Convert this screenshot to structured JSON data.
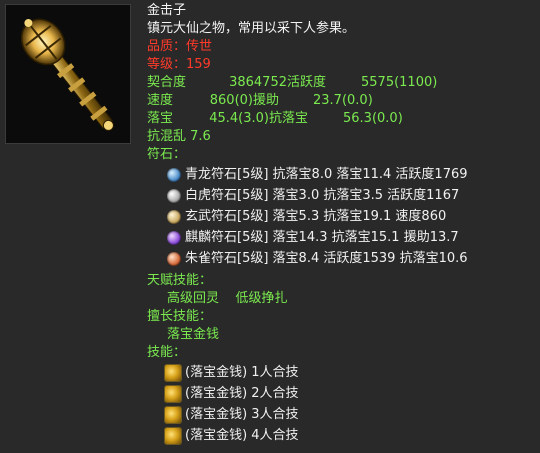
{
  "item": {
    "name": "金击子",
    "description": "镇元大仙之物，常用以采下人参果。",
    "quality_label": "品质：",
    "quality_value": "传世",
    "level_label": "等级：",
    "level_value": "159"
  },
  "stats": {
    "compat_label": "契合度",
    "compat_value": "3864752",
    "activity_label": "活跃度",
    "activity_value": "5575(1100)",
    "speed_label": "速度",
    "speed_value": "860(0)",
    "assist_label": "援助",
    "assist_value": "23.7(0.0)",
    "drop_label": "落宝",
    "drop_value": "45.4(3.0)",
    "anti_drop_label": "抗落宝",
    "anti_drop_value": "56.3(0.0)",
    "anti_chaos": "抗混乱 7.6"
  },
  "runes": {
    "header": "符石：",
    "items": [
      {
        "text": "青龙符石[5级] 抗落宝8.0 落宝11.4 活跃度1769",
        "color": "#6aa8d8"
      },
      {
        "text": "白虎符石[5级] 落宝3.0 抗落宝3.5 活跃度1167",
        "color": "#d0d0d0"
      },
      {
        "text": "玄武符石[5级] 落宝5.3 抗落宝19.1 速度860",
        "color": "#c9b07a"
      },
      {
        "text": "麒麟符石[5级] 落宝14.3 抗落宝15.1 援助13.7",
        "color": "#9a6ad8"
      },
      {
        "text": "朱雀符石[5级] 落宝8.4 活跃度1539 抗落宝10.6",
        "color": "#d86a3a"
      }
    ]
  },
  "talent": {
    "header": "天赋技能：",
    "value": "高级回灵    低级挣扎"
  },
  "specialty": {
    "header": "擅长技能：",
    "value": "落宝金钱"
  },
  "skills": {
    "header": "技能：",
    "items": [
      "(落宝金钱) 1人合技",
      "(落宝金钱) 2人合技",
      "(落宝金钱) 3人合技",
      "(落宝金钱) 4人合技"
    ]
  }
}
